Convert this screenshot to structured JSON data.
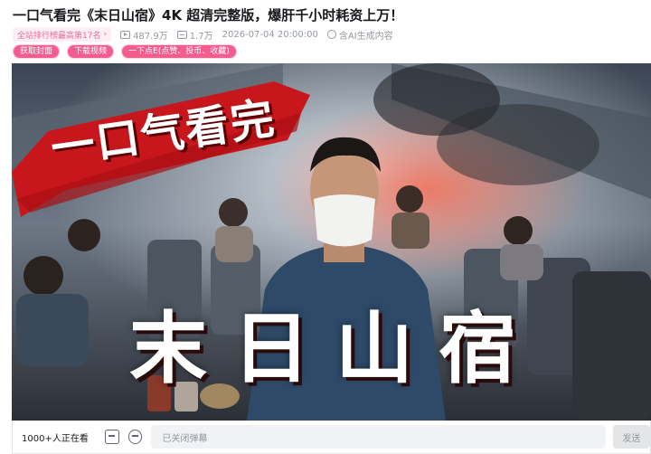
{
  "video": {
    "title": "一口气看完《末日山宿》4K 超清完整版，爆肝千小时耗资上万！",
    "rank_badge": "全站排行榜最高第17名",
    "rank_badge_chevron": "›",
    "views": "487.9万",
    "danmaku_count": "1.7万",
    "publish_time": "2026-07-04 20:00:00",
    "ai_note": "含AI生成内容"
  },
  "actions": {
    "get_cover": "获取封面",
    "download_video": "下载视频",
    "triple_action": "一下点E(点赞、投币、收藏)"
  },
  "thumbnail": {
    "banner_text": "一口气看完",
    "main_title": "末日山宿"
  },
  "player_bar": {
    "viewers": "1000+人正在看",
    "danmaku_placeholder": "已关闭弹幕",
    "send_label": "发送"
  },
  "colors": {
    "accent_pink": "#f25d8e",
    "banner_red": "#c8171c"
  },
  "icons": [
    "play-count-icon",
    "danmaku-count-icon",
    "ai-content-icon",
    "danmaku-settings-icon",
    "danmaku-toggle-icon"
  ]
}
